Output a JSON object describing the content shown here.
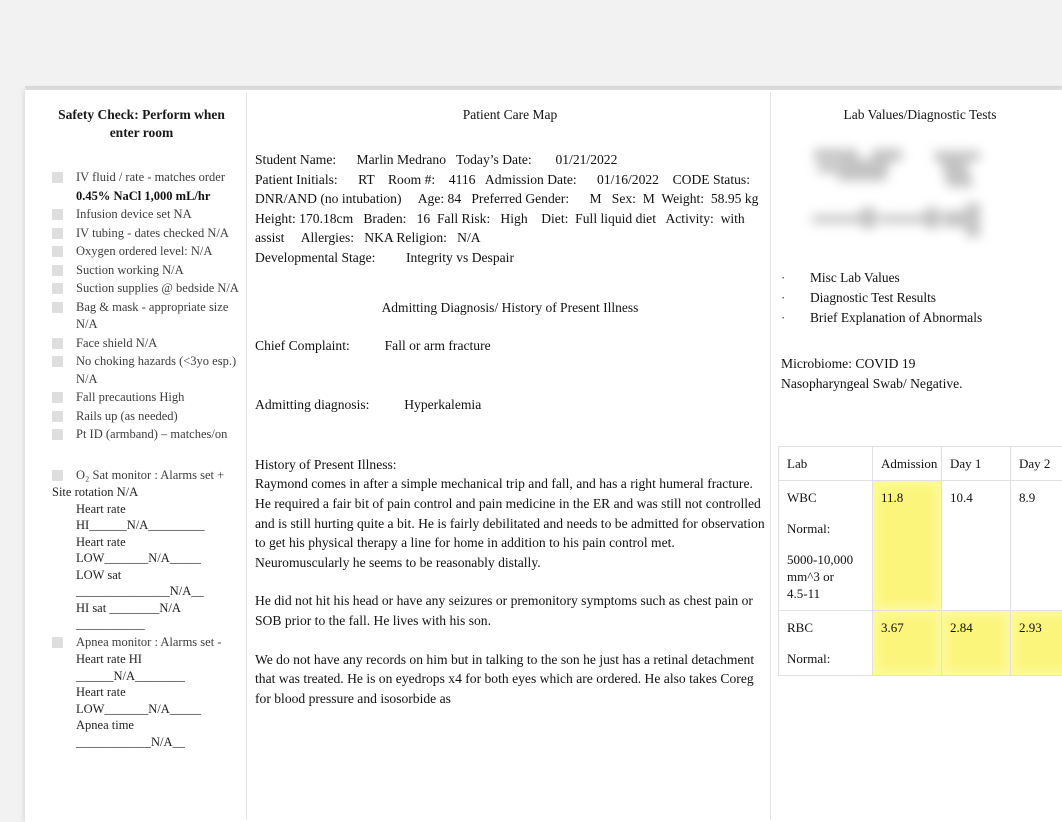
{
  "left_column": {
    "title_line1": "Safety Check: Perform when",
    "title_line2": "enter room",
    "checklist": [
      {
        "text": "IV fluid   / rate     - matches order",
        "box": true
      },
      {
        "text": "0.45% NaCl 1,000 mL/hr",
        "box": false,
        "bold": true
      },
      {
        "text": "Infusion device      set NA",
        "box": true
      },
      {
        "text": "IV tubing   - dates checked N/A",
        "box": true
      },
      {
        "text": "Oxygen ordered level:           N/A",
        "box": true
      },
      {
        "text": "Suction   working N/A",
        "box": true
      },
      {
        "text": "Suction   supplies @ bedside N/A",
        "box": true
      },
      {
        "text": "Bag & mask   - appropriate size N/A",
        "box": true
      },
      {
        "text": "Face shield     N/A",
        "box": true
      },
      {
        "text": "No choking hazards       (<3yo esp.)   N/A",
        "box": true
      },
      {
        "text": "Fall precautions         High",
        "box": true
      },
      {
        "text": "Rails up   (as needed)",
        "box": true
      },
      {
        "text": "Pt ID (armband) – matches/on",
        "box": true
      }
    ],
    "monitor_block": {
      "o2_line": "O₂ Sat monitor   :  Alarms set +",
      "site_rotation": "Site rotation   N/A",
      "lines": [
        "Heart rate",
        "HI______N/A_________",
        "Heart rate LOW_______N/A_____",
        "LOW sat _______________N/A__",
        "HI sat ________N/A ___________"
      ],
      "apnea_header": "Apnea monitor    :  Alarms set -",
      "apnea_lines": [
        "Heart rate HI ______N/A________",
        "Heart rate LOW_______N/A_____",
        "Apnea time ____________N/A__"
      ]
    }
  },
  "middle_column": {
    "title": "Patient Care Map",
    "header_block": "Student Name:      Marlin Medrano   Today’s Date:       01/21/2022\nPatient Initials:      RT    Room #:    4116   Admission Date:      01/16/2022    CODE Status:    DNR/AND (no intubation)     Age: 84   Preferred Gender:      M   Sex:  M  Weight:  58.95 kg   Height: 170.18cm   Braden:   16  Fall Risk:   High    Diet:  Full liquid diet   Activity:  with assist     Allergies:   NKA Religion:   N/A\nDevelopmental Stage:         Integrity vs Despair",
    "section_title": "Admitting Diagnosis/ History of Present Illness",
    "chief_complaint_label": "Chief Complaint:",
    "chief_complaint_value": "Fall or arm fracture",
    "admitting_label": "Admitting diagnosis:",
    "admitting_value": "Hyperkalemia",
    "hpi_label": "History of Present Illness:",
    "hpi_paragraph_1": "Raymond comes in after a simple mechanical trip and fall, and has a right humeral fracture. He required a fair bit of pain control and pain medicine in the ER and was still not controlled and is still hurting quite a bit. He is fairly debilitated and needs to be admitted for observation to get his physical therapy a line for home in addition to his pain control met. Neuromuscularly he seems to be reasonably distally.",
    "hpi_paragraph_2": "He did not hit his head or have any seizures or premonitory symptoms such as chest pain or SOB prior to the fall. He lives with his son.",
    "hpi_paragraph_3": "We do not have any records on him but in talking to the son he just has a retinal detachment that was treated. He is on eyedrops x4 for both eyes which are ordered. He also takes Coreg for blood pressure and isosorbide as"
  },
  "right_column": {
    "title": "Lab Values/Diagnostic Tests",
    "bullets": [
      "Misc Lab Values",
      "Diagnostic Test Results",
      "Brief Explanation of Abnormals"
    ],
    "bullet_char": "·",
    "microbiome_line1": "Microbiome:    COVID 19",
    "microbiome_line2": "Nasopharyngeal Swab/ Negative."
  },
  "lab_table": {
    "columns": [
      "Lab",
      "Admission",
      "Day 1",
      "Day 2"
    ],
    "rows": [
      {
        "lab": "WBC",
        "normal_label": "Normal:",
        "normal_range": "5000-10,000 mm^3 or\n4.5-11",
        "values": [
          {
            "text": "11.8",
            "highlight": true
          },
          {
            "text": "10.4",
            "highlight": false
          },
          {
            "text": "8.9",
            "highlight": false
          }
        ]
      },
      {
        "lab": "RBC",
        "normal_label": "Normal:",
        "normal_range": "",
        "values": [
          {
            "text": "3.67",
            "highlight": true
          },
          {
            "text": "2.84",
            "highlight": true
          },
          {
            "text": "2.93",
            "highlight": true
          }
        ]
      }
    ]
  },
  "colors": {
    "highlight": "#fbf57c",
    "page_background": "#f2f2f2",
    "sheet": "#ffffff",
    "divider": "#e3e3e3",
    "text": "#111111"
  }
}
